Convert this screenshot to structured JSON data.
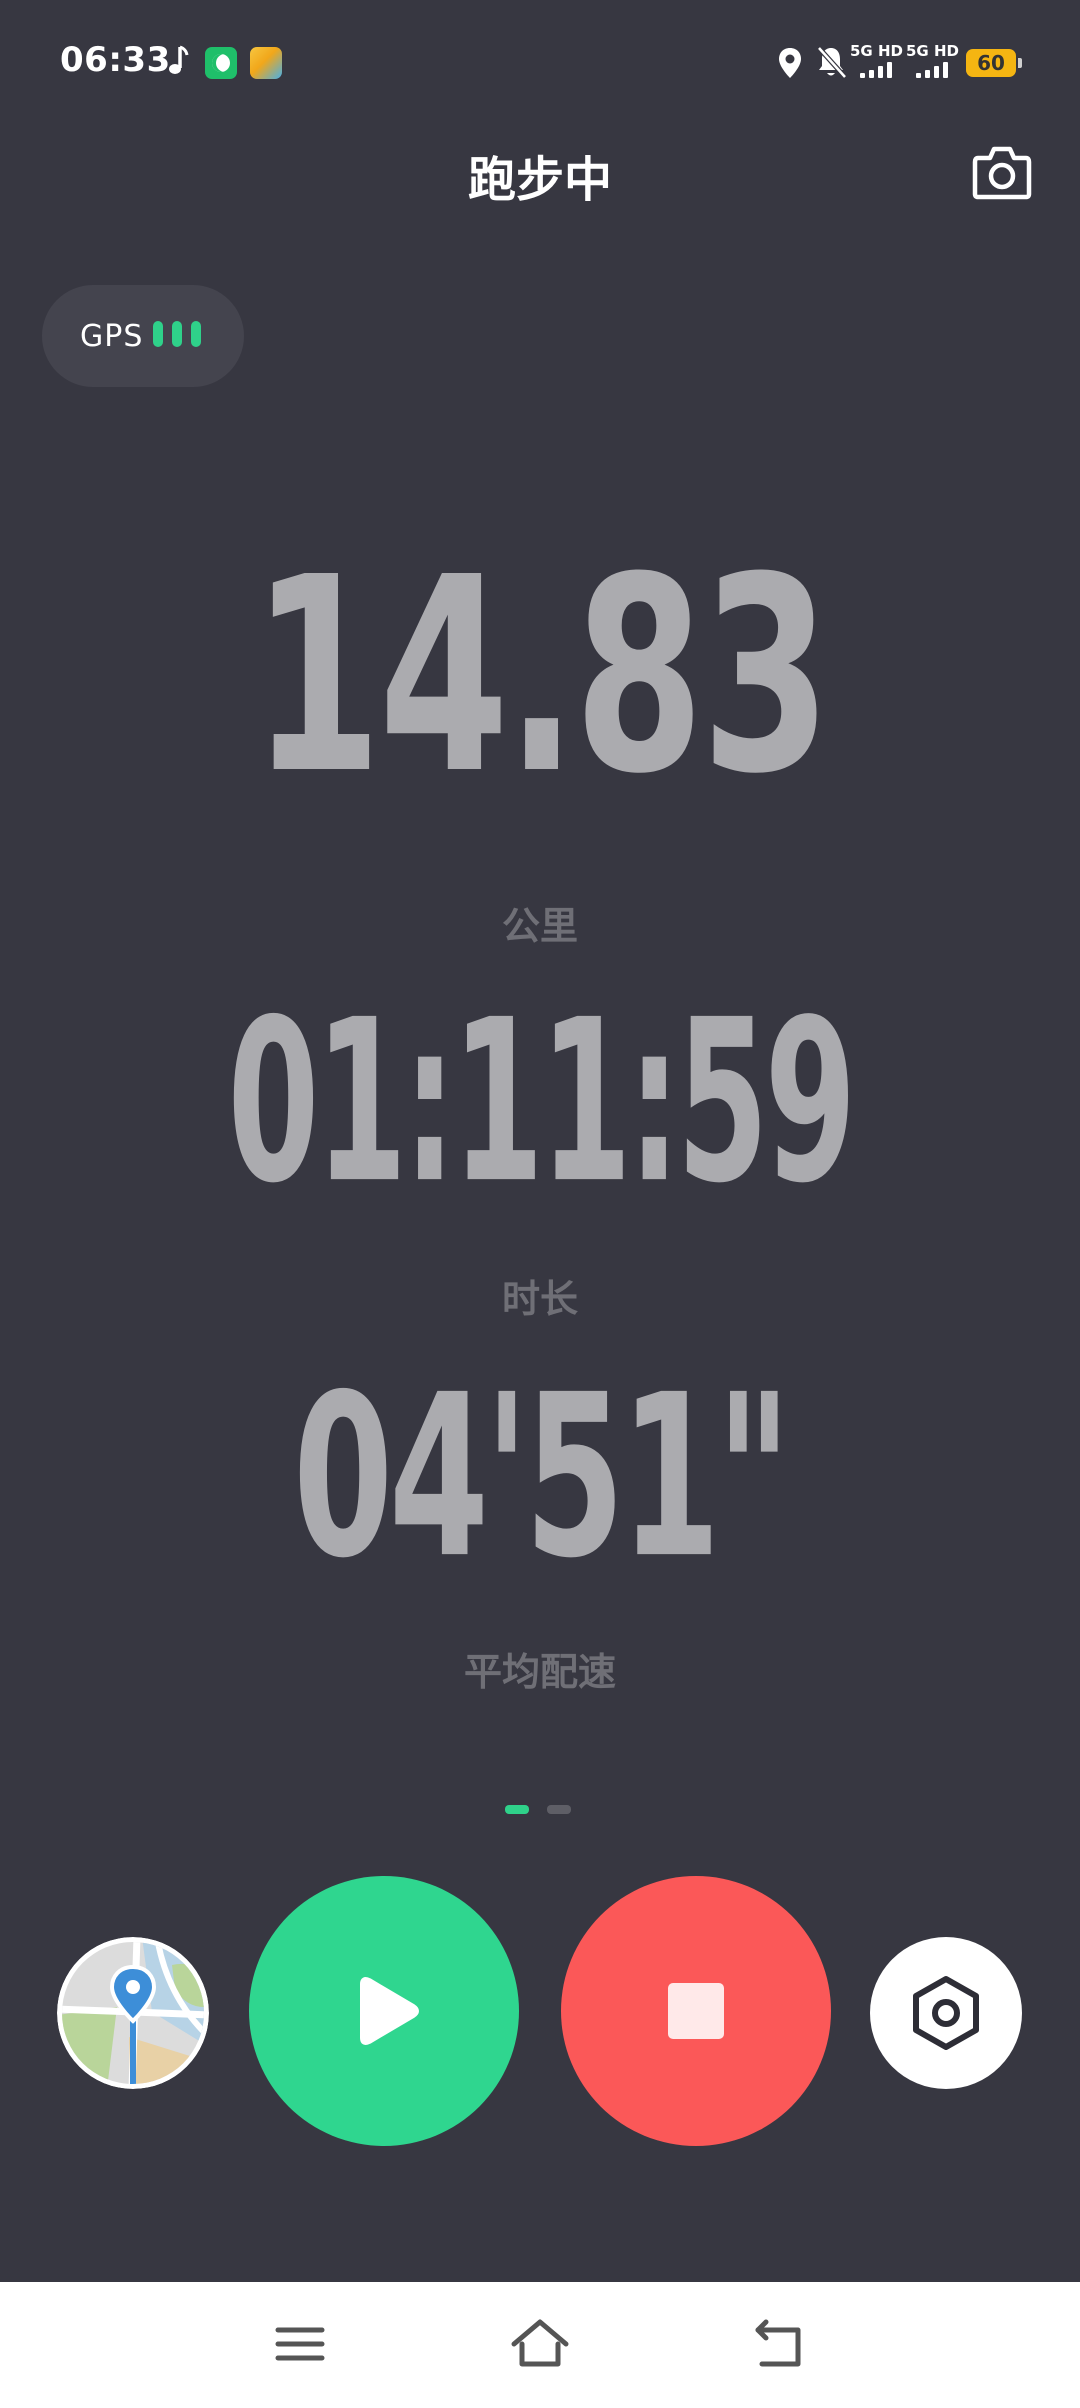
{
  "status_bar": {
    "time": "06:33",
    "network_1": "5G HD",
    "network_2": "5G HD",
    "battery": "60",
    "icons": [
      "music-note-icon",
      "app-notification-icon",
      "app-notification-icon",
      "location-icon",
      "bell-off-icon",
      "signal-icon",
      "battery-icon"
    ]
  },
  "header": {
    "title": "跑步中",
    "camera_icon": "camera-icon"
  },
  "gps": {
    "label": "GPS",
    "signal_bars": 3,
    "signal_color": "#2fd18a"
  },
  "metrics": {
    "distance": {
      "value": "14.83",
      "unit": "公里"
    },
    "duration": {
      "value": "01:11:59",
      "label": "时长"
    },
    "pace": {
      "value": "04'51\"",
      "label": "平均配速"
    }
  },
  "pager": {
    "pages": 2,
    "active_index": 0
  },
  "controls": {
    "map_icon": "map-pin-icon",
    "play_icon": "play-icon",
    "stop_icon": "stop-icon",
    "settings_icon": "hexagon-settings-icon",
    "play_color": "#2fd68f",
    "stop_color": "#fb5858"
  },
  "nav_bar": {
    "icons": [
      "menu-icon",
      "home-icon",
      "back-icon"
    ]
  },
  "colors": {
    "background": "#373741",
    "metric_text": "#ababaf",
    "label_text": "#6f6f76",
    "accent": "#2fd18a"
  }
}
